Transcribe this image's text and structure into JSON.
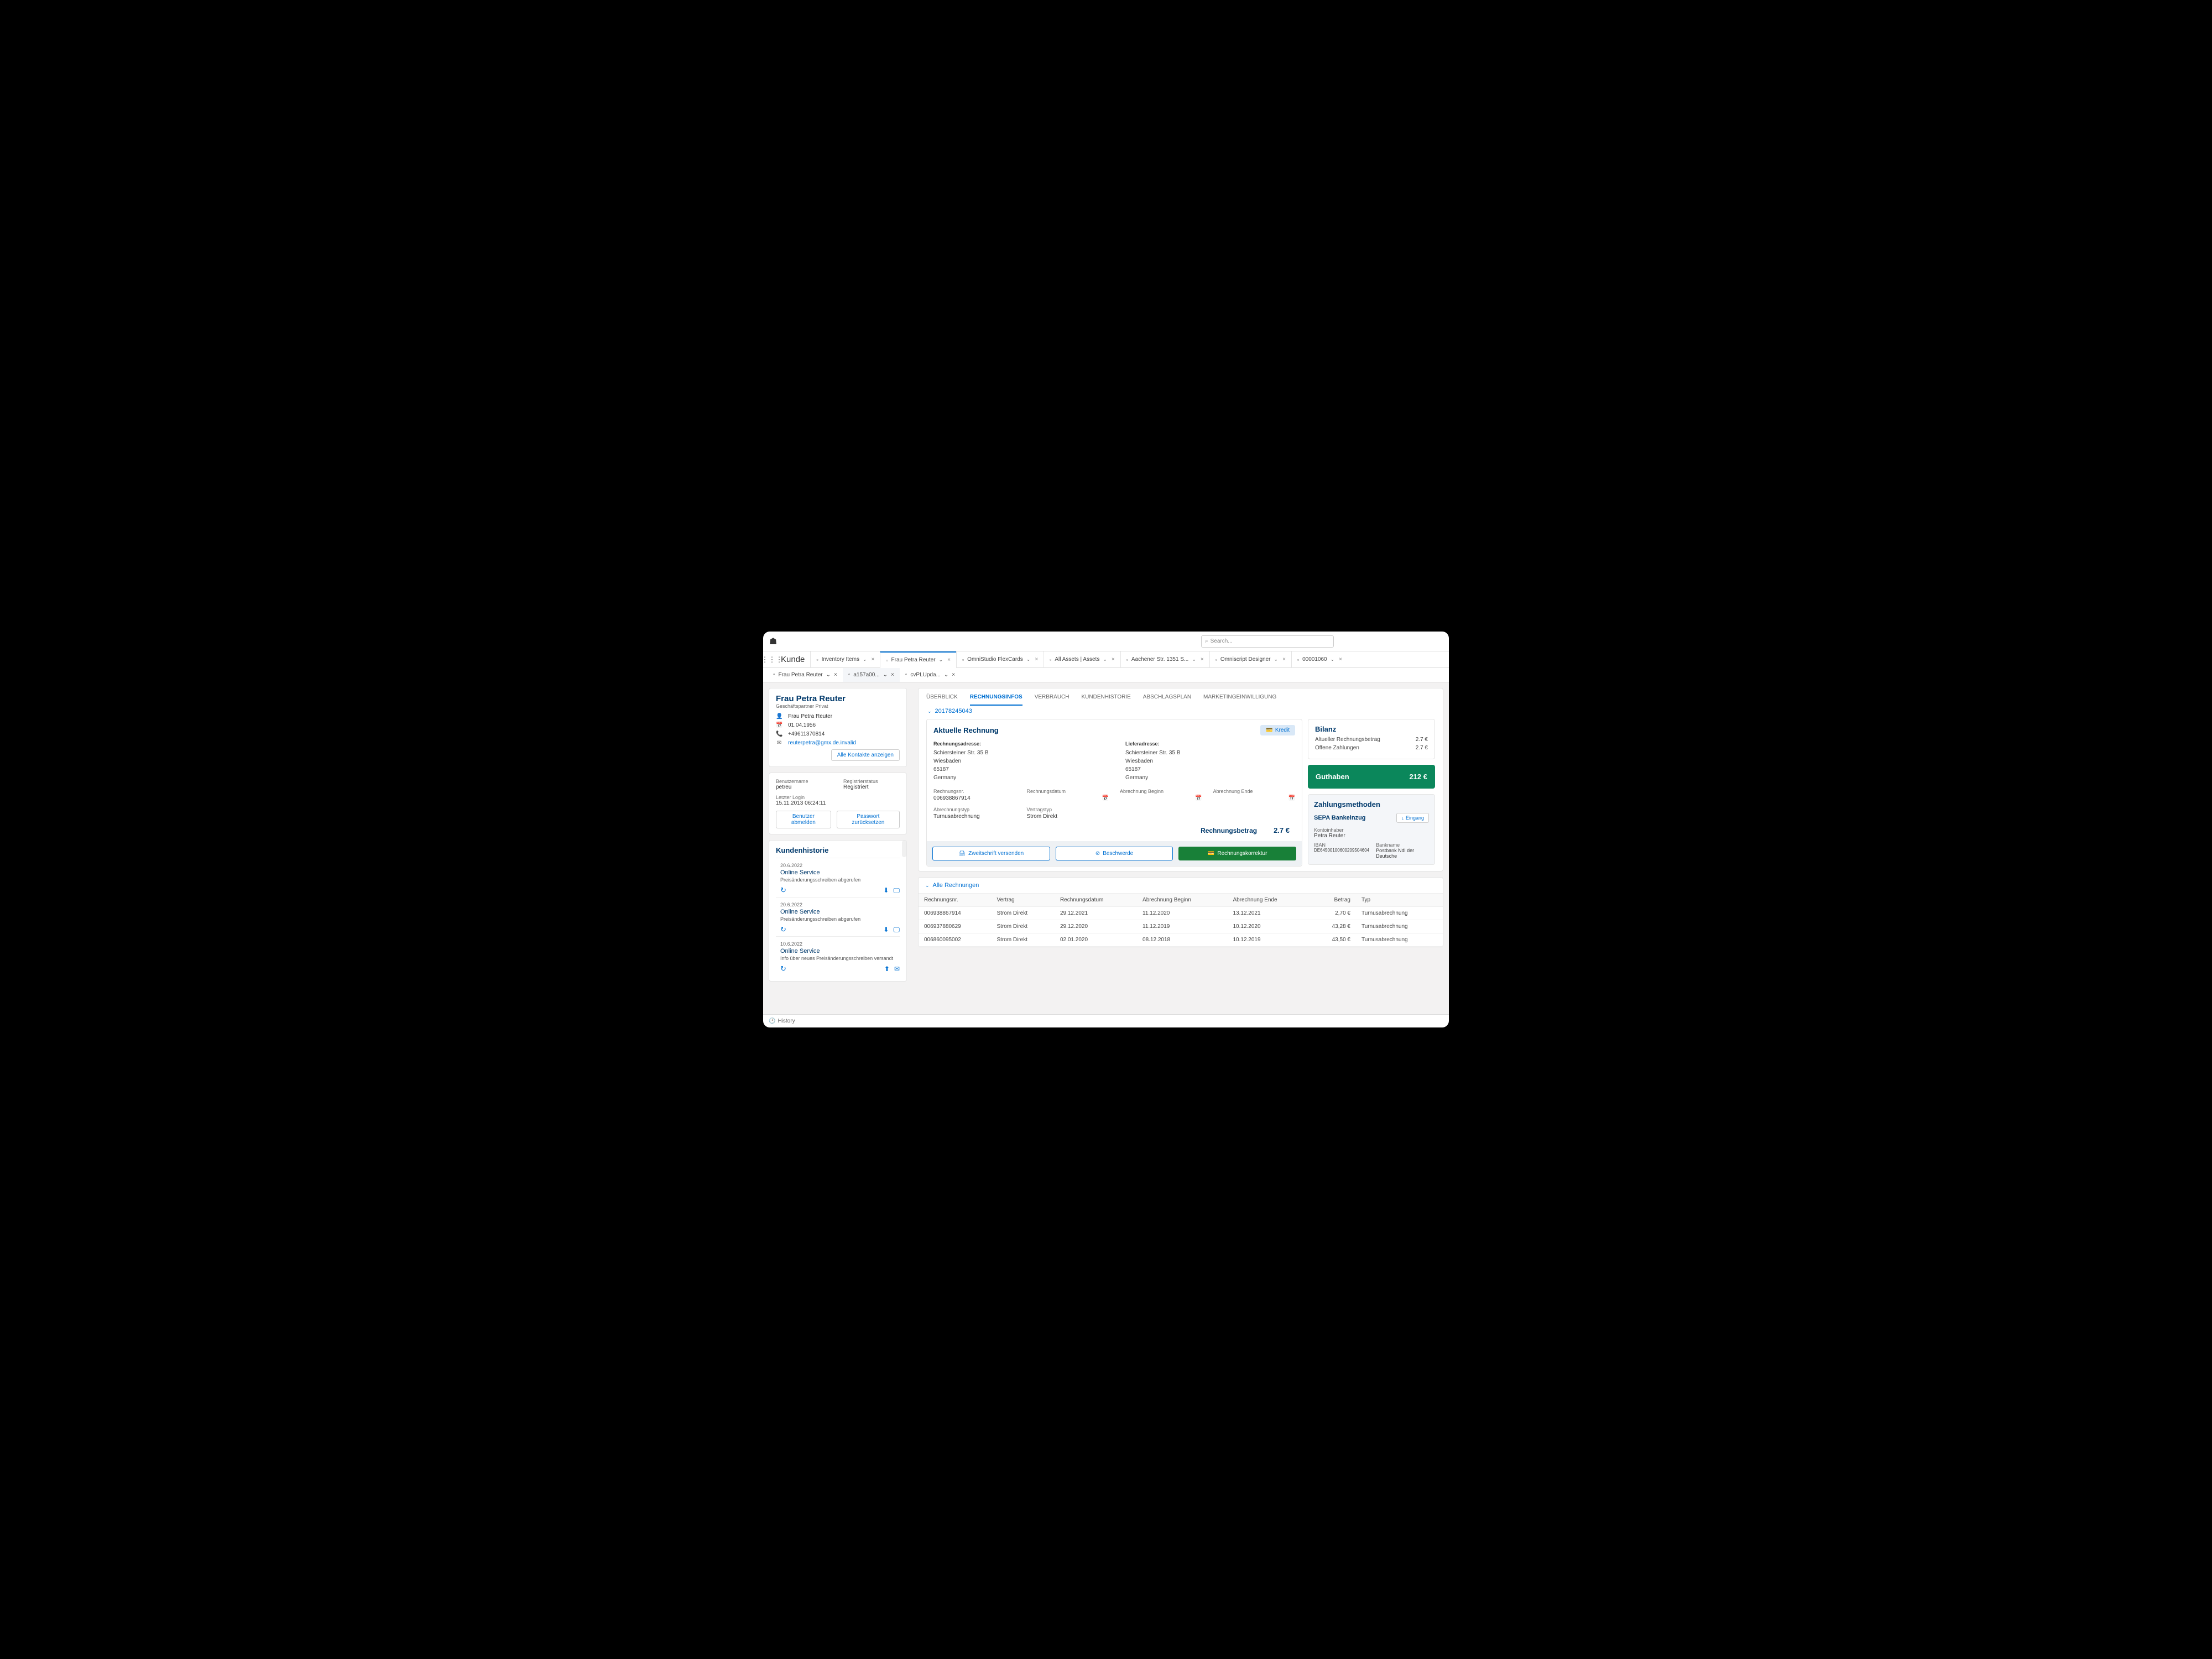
{
  "header": {
    "search_placeholder": "Search..."
  },
  "nav": {
    "title": "Kunde",
    "tabs": [
      {
        "label": "Inventory Items",
        "active": false
      },
      {
        "label": "Frau Petra Reuter",
        "active": true
      },
      {
        "label": "OmniStudio FlexCards",
        "active": false
      },
      {
        "label": "All Assets | Assets",
        "active": false
      },
      {
        "label": "Aachener Str. 1351 S...",
        "active": false
      },
      {
        "label": "Omniscript Designer",
        "active": false
      },
      {
        "label": "00001060",
        "active": false
      }
    ],
    "subtabs": [
      {
        "label": "Frau Petra Reuter",
        "active": false
      },
      {
        "label": "a157a00...",
        "active": true
      },
      {
        "label": "cvPLUpda...",
        "active": false
      }
    ]
  },
  "customer": {
    "name": "Frau Petra Reuter",
    "subtitle": "Geschäftspartner Privat",
    "full_name": "Frau Petra Reuter",
    "dob": "01.04.1956",
    "phone": "+49611370814",
    "email": "reuterpetra@gmx.de.invalid",
    "btn_all_contacts": "Alle Kontakte anzeigen"
  },
  "user_box": {
    "lbl_username": "Benutzername",
    "username": "petreu",
    "lbl_status": "Registrierstatus",
    "status": "Registriert",
    "lbl_last_login": "Letzter Login",
    "last_login": "15.11.2013 06:24:11",
    "btn_logout": "Benutzer abmelden",
    "btn_reset": "Passwort zurücksetzen"
  },
  "history": {
    "title": "Kundenhistorie",
    "items": [
      {
        "date": "20.6.2022",
        "type": "Online Service",
        "desc": "Preisänderungsschreiben abgerufen",
        "icons": "dl-screen"
      },
      {
        "date": "20.6.2022",
        "type": "Online Service",
        "desc": "Preisänderungsschreiben abgerufen",
        "icons": "dl-screen"
      },
      {
        "date": "10.6.2022",
        "type": "Online Service",
        "desc": "Info über neues Preisänderungsschreiben versandt",
        "icons": "up-mail"
      }
    ]
  },
  "main_tabs": [
    "ÜBERBLICK",
    "RECHNUNGSINFOS",
    "VERBRAUCH",
    "KUNDENHISTORIE",
    "ABSCHLAGSPLAN",
    "MARKETINGEINWILLIGUNG"
  ],
  "main_active": "RECHNUNGSINFOS",
  "account_number": "20178245043",
  "invoice": {
    "title": "Aktuelle Rechnung",
    "btn_kredit": "Kredit",
    "lbl_bill_addr": "Rechnungsadresse:",
    "lbl_ship_addr": "Lieferadresse:",
    "addr1": "Schiersteiner Str. 35 B",
    "addr2": "Wiesbaden",
    "addr3": "65187",
    "addr4": "Germany",
    "lbl_inv_no": "Rechnungsnr.",
    "inv_no": "006938867914",
    "lbl_inv_date": "Rechnungsdatum",
    "lbl_period_start": "Abrechnung Beginn",
    "lbl_period_end": "Abrechnung Ende",
    "lbl_bill_type": "Abrechnungstyp",
    "bill_type": "Turnusabrechnung",
    "lbl_contract_type": "Vertragstyp",
    "contract_type": "Strom Direkt",
    "lbl_total": "Rechnungsbetrag",
    "total": "2.7 €",
    "btn_copy": "Zweitschrift versenden",
    "btn_complaint": "Beschwerde",
    "btn_correction": "Rechnungskorrektur"
  },
  "bilanz": {
    "title": "Bilanz",
    "lbl_current": "Altueller Rechnungsbetrag",
    "val_current": "2.7 €",
    "lbl_open": "Offene Zahlungen",
    "val_open": "2.7 €",
    "lbl_credit": "Guthaben",
    "val_credit": "212 €"
  },
  "payment": {
    "title": "Zahlungsmethoden",
    "method": "SEPA Bankeinzug",
    "btn_eingang": "Eingang",
    "lbl_holder": "Kontoinhaber",
    "holder": "Petra Reuter",
    "lbl_iban": "IBAN",
    "iban": "DE64500100600209504604",
    "lbl_bank": "Bankname",
    "bank": "Postbank Ndl der Deutsche"
  },
  "all_invoices": {
    "title": "Alle Rechnungen",
    "columns": [
      "Rechnungsnr.",
      "Vertrag",
      "Rechnungsdatum",
      "Abrechnung Beginn",
      "Abrechnung Ende",
      "Betrag",
      "Typ"
    ],
    "rows": [
      {
        "nr": "006938867914",
        "vertrag": "Strom Direkt",
        "datum": "29.12.2021",
        "beginn": "11.12.2020",
        "ende": "13.12.2021",
        "betrag": "2,70 €",
        "typ": "Turnusabrechnung"
      },
      {
        "nr": "006937880629",
        "vertrag": "Strom Direkt",
        "datum": "29.12.2020",
        "beginn": "11.12.2019",
        "ende": "10.12.2020",
        "betrag": "43,28 €",
        "typ": "Turnusabrechnung"
      },
      {
        "nr": "006860095002",
        "vertrag": "Strom Direkt",
        "datum": "02.01.2020",
        "beginn": "08.12.2018",
        "ende": "10.12.2019",
        "betrag": "43,50 €",
        "typ": "Turnusabrechnung"
      }
    ]
  },
  "footer_history": "History"
}
